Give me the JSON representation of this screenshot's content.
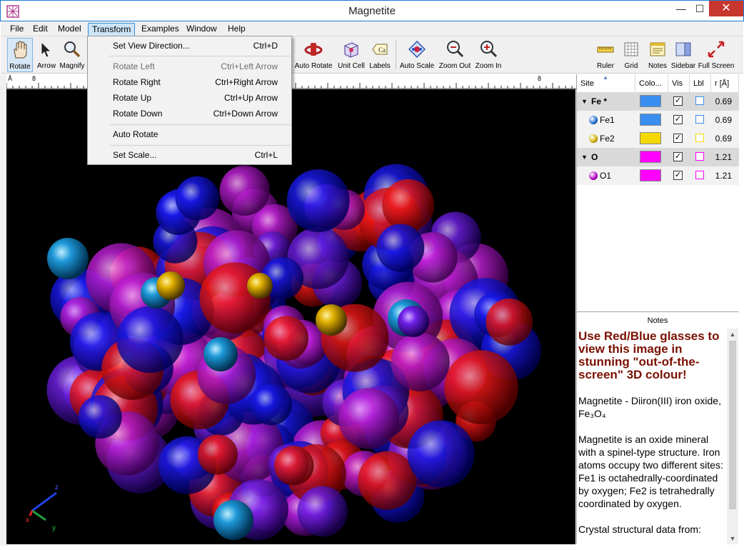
{
  "window": {
    "title": "Magnetite",
    "minimize": "—",
    "maximize": "☐",
    "close": "✕"
  },
  "menu": [
    "File",
    "Edit",
    "Model",
    "Transform",
    "Examples",
    "Window",
    "Help"
  ],
  "toolbar": {
    "rotate": "Rotate",
    "arrow": "Arrow",
    "magnify": "Magnify",
    "auto_rotate": "Auto Rotate",
    "unit_cell": "Unit Cell",
    "labels": "Labels",
    "auto_scale": "Auto Scale",
    "zoom_out": "Zoom Out",
    "zoom_in": "Zoom In",
    "ruler": "Ruler",
    "grid": "Grid",
    "notes": "Notes",
    "sidebar": "Sidebar",
    "full_screen": "Full Screen",
    "labels_icon_text": "Ca"
  },
  "ruler": {
    "unit": "Å",
    "marks": [
      "8",
      "8",
      "8"
    ]
  },
  "transform_menu": {
    "set_view_direction": {
      "label": "Set View Direction...",
      "shortcut": "Ctrl+D"
    },
    "rotate_left": {
      "label": "Rotate Left",
      "shortcut": "Ctrl+Left Arrow"
    },
    "rotate_right": {
      "label": "Rotate Right",
      "shortcut": "Ctrl+Right Arrow"
    },
    "rotate_up": {
      "label": "Rotate Up",
      "shortcut": "Ctrl+Up Arrow"
    },
    "rotate_down": {
      "label": "Rotate Down",
      "shortcut": "Ctrl+Down Arrow"
    },
    "auto_rotate": {
      "label": "Auto Rotate"
    },
    "set_scale": {
      "label": "Set Scale...",
      "shortcut": "Ctrl+L"
    }
  },
  "site_table": {
    "headers": {
      "site": "Site",
      "colour": "Colo...",
      "vis": "Vis",
      "lbl": "Lbl",
      "radius": "r [Å]"
    },
    "rows": [
      {
        "site": "Fe  *",
        "kind": "group",
        "color": "#3a8ef0",
        "radius": "0.69"
      },
      {
        "site": "Fe1",
        "kind": "sub",
        "color": "#3a8ef0",
        "ball": "#1e6fd0",
        "radius": "0.69"
      },
      {
        "site": "Fe2",
        "kind": "sub",
        "color": "#f5d800",
        "ball": "#d4b000",
        "radius": "0.69"
      },
      {
        "site": "O",
        "kind": "group",
        "color": "#ff00ff",
        "radius": "1.21"
      },
      {
        "site": "O1",
        "kind": "sub",
        "color": "#ff00ff",
        "ball": "#b400c8",
        "radius": "1.21"
      }
    ],
    "check_mark": "✓"
  },
  "notes": {
    "header": "Notes",
    "headline": "Use Red/Blue glasses to view this image in stunning \"out-of-the-screen\" 3D colour!",
    "p1": "Magnetite - Diiron(III) iron oxide, Fe₃O₄",
    "p2": "Magnetite is an oxide mineral with a spinel-type structure. Iron atoms occupy two different sites: Fe1 is octahedrally-coordinated by oxygen; Fe2 is tetrahedrally coordinated by oxygen.",
    "p3": "Crystal structural data from:"
  },
  "axes": {
    "x": "x",
    "y": "y",
    "z": "z"
  },
  "colors": {
    "accent": "#1c7ad6",
    "close": "#c7372f",
    "notes_title": "#7a1000"
  }
}
